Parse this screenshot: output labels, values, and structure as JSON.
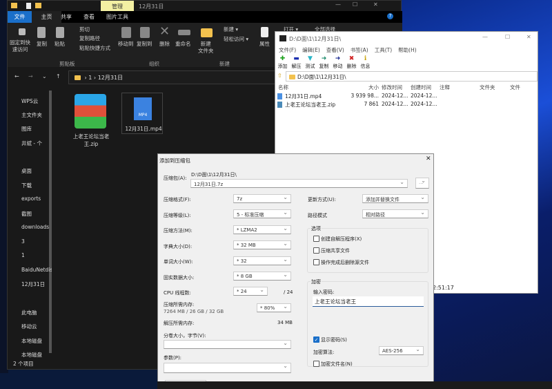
{
  "explorer": {
    "context_tab": "管理",
    "title": "12月31日",
    "tabs": [
      "文件",
      "主页",
      "共享",
      "查看",
      "图片工具"
    ],
    "ribbon": {
      "pin": "固定到快\n速访问",
      "copy": "复制",
      "paste": "粘贴",
      "cut": "剪切",
      "copy_path": "复制路径",
      "paste_shortcut": "粘贴快捷方式",
      "move_to": "移动到",
      "copy_to": "复制到",
      "delete": "删除",
      "rename": "重命名",
      "new_folder": "新建\n文件夹",
      "new_item": "新建 ▾",
      "easy_access": "轻松访问 ▾",
      "properties": "属性",
      "open": "打开 ▾",
      "select_all": "全部选择",
      "group_clipboard": "剪贴板",
      "group_organize": "组织",
      "group_new": "新建"
    },
    "breadcrumb": [
      "1",
      "12月31日"
    ],
    "nav": [
      "WPS云",
      "主文件夹",
      "图库",
      "井斌 - 个",
      "桌面",
      "下载",
      "exports",
      "截图",
      "downloads",
      "3",
      "1",
      "BaiduNetdisk",
      "12月31日",
      "此电脑",
      "移动云",
      "本地磁盘",
      "本地磁盘"
    ],
    "files": [
      {
        "name": "上老王论坛当老王.zip",
        "icon": "winrar-archive-icon"
      },
      {
        "name": "12月31日.mp4",
        "icon": "mp4-file-icon",
        "badge": "MP4"
      }
    ],
    "status": "2 个项目"
  },
  "sevenzip": {
    "title": "D:\\D面\\1\\12月31日\\",
    "menu": [
      "文件(F)",
      "编辑(E)",
      "查看(V)",
      "书签(A)",
      "工具(T)",
      "帮助(H)"
    ],
    "toolbar": [
      {
        "label": "添加",
        "icon": "plus-icon",
        "color": "#1aa01a"
      },
      {
        "label": "解压",
        "icon": "minus-icon",
        "color": "#1c2fb0"
      },
      {
        "label": "测试",
        "icon": "check-icon",
        "color": "#29b6c8"
      },
      {
        "label": "复制",
        "icon": "arrow-right-icon",
        "color": "#1a8a6a"
      },
      {
        "label": "移动",
        "icon": "arrow-right-icon",
        "color": "#1a2a90"
      },
      {
        "label": "删除",
        "icon": "x-icon",
        "color": "#d02020"
      },
      {
        "label": "信息",
        "icon": "info-icon",
        "color": "#c8a000"
      }
    ],
    "path": "D:\\D面\\1\\12月31日\\",
    "columns": [
      "名称",
      "大小",
      "修改时间",
      "创建时间",
      "注释",
      "文件夹",
      "文件"
    ],
    "rows": [
      {
        "name": "12月31日.mp4",
        "size": "3 939 98...",
        "modified": "2024-12...",
        "created": "2024-12..."
      },
      {
        "name": "上老王论坛当老王.zip",
        "size": "7 861",
        "modified": "2024-12...",
        "created": "2024-12..."
      }
    ],
    "status_time": "2:51:17"
  },
  "dialog": {
    "title": "添加到压缩包",
    "archive_label": "压缩包(A):",
    "archive_dir": "D:\\D面\\1\\12月31日\\",
    "archive_name": "12月31日.7z",
    "browse": "...",
    "format_label": "压缩格式(F):",
    "format": "7z",
    "level_label": "压缩等级(L):",
    "level": "5 - 标准压缩",
    "method_label": "压缩方法(M):",
    "method": "* LZMA2",
    "dict_label": "字典大小(D):",
    "dict": "* 32 MB",
    "word_label": "单词大小(W):",
    "word": "* 32",
    "solid_label": "固实数据大小:",
    "solid": "* 8 GB",
    "cpu_label": "CPU 线程数:",
    "cpu": "* 24",
    "cpu_max": "/ 24",
    "mem_label": "压缩所需内存:",
    "mem_detail": "7264 MB / 26 GB / 32 GB",
    "mem": "* 80%",
    "decomp_label": "解压所需内存:",
    "decomp": "34 MB",
    "split_label": "分卷大小，字节(V):",
    "split": "",
    "params_label": "参数(P):",
    "params": "",
    "update_label": "更新方式(U):",
    "update": "添加并替换文件",
    "path_label": "路径模式",
    "path_mode": "相对路径",
    "options_label": "选项",
    "options": [
      {
        "label": "创建自解压程序(X)",
        "checked": false
      },
      {
        "label": "压缩共享文件",
        "checked": false
      },
      {
        "label": "操作完成后删除源文件",
        "checked": false
      }
    ],
    "encrypt_label": "加密",
    "password_label": "输入密码:",
    "password": "上老王论坛当老王",
    "show_password": "显示密码(S)",
    "show_password_checked": true,
    "algo_label": "加密算法:",
    "algo": "AES-256",
    "encrypt_names": "加密文件名(N)",
    "encrypt_names_checked": false
  }
}
